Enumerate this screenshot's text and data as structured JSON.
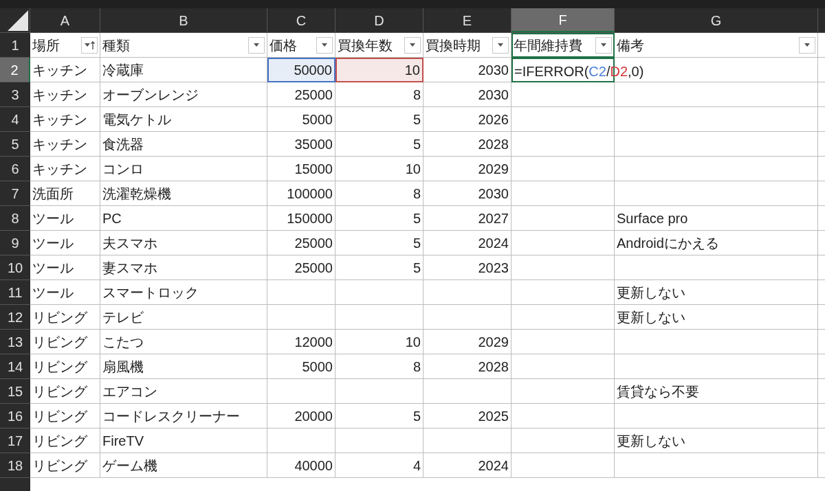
{
  "columns": [
    {
      "letter": "A",
      "selected": false,
      "kind": "text"
    },
    {
      "letter": "B",
      "selected": false,
      "kind": "text"
    },
    {
      "letter": "C",
      "selected": false,
      "kind": "number"
    },
    {
      "letter": "D",
      "selected": false,
      "kind": "number"
    },
    {
      "letter": "E",
      "selected": false,
      "kind": "number"
    },
    {
      "letter": "F",
      "selected": true,
      "kind": "number"
    },
    {
      "letter": "G",
      "selected": false,
      "kind": "text"
    }
  ],
  "rows": [
    {
      "number": "1",
      "selected": false,
      "kind": "header",
      "cells": [
        {
          "text": "場所",
          "kind": "sorted"
        },
        {
          "text": "種類",
          "kind": "dropdown"
        },
        {
          "text": "価格",
          "kind": "dropdown"
        },
        {
          "text": "買換年数",
          "kind": "dropdown"
        },
        {
          "text": "買換時期",
          "kind": "dropdown"
        },
        {
          "text": "年間維持費",
          "kind": "dropdown"
        },
        {
          "text": "備考",
          "kind": "dropdown"
        }
      ]
    },
    {
      "number": "2",
      "selected": true,
      "kind": "data",
      "cells": [
        {
          "text": "キッチン"
        },
        {
          "text": "冷蔵庫"
        },
        {
          "text": "50000",
          "color": "#4472c4"
        },
        {
          "text": "10",
          "color": "#c0504d"
        },
        {
          "text": "2030"
        },
        {
          "formula": [
            {
              "text": "=IFERROR("
            },
            {
              "text": "C2",
              "color": "#4a7fd9"
            },
            {
              "text": "/"
            },
            {
              "text": "D2",
              "color": "#d13438"
            },
            {
              "text": ",0)"
            }
          ]
        },
        {}
      ]
    },
    {
      "number": "3",
      "selected": false,
      "kind": "data",
      "cells": [
        {
          "text": "キッチン"
        },
        {
          "text": "オーブンレンジ"
        },
        {
          "text": "25000"
        },
        {
          "text": "8"
        },
        {
          "text": "2030"
        },
        {},
        {}
      ]
    },
    {
      "number": "4",
      "selected": false,
      "kind": "data",
      "cells": [
        {
          "text": "キッチン"
        },
        {
          "text": "電気ケトル"
        },
        {
          "text": "5000"
        },
        {
          "text": "5"
        },
        {
          "text": "2026"
        },
        {},
        {}
      ]
    },
    {
      "number": "5",
      "selected": false,
      "kind": "data",
      "cells": [
        {
          "text": "キッチン"
        },
        {
          "text": "食洗器"
        },
        {
          "text": "35000"
        },
        {
          "text": "5"
        },
        {
          "text": "2028"
        },
        {},
        {}
      ]
    },
    {
      "number": "6",
      "selected": false,
      "kind": "data",
      "cells": [
        {
          "text": "キッチン"
        },
        {
          "text": "コンロ"
        },
        {
          "text": "15000"
        },
        {
          "text": "10"
        },
        {
          "text": "2029"
        },
        {},
        {}
      ]
    },
    {
      "number": "7",
      "selected": false,
      "kind": "data",
      "cells": [
        {
          "text": "洗面所"
        },
        {
          "text": "洗濯乾燥機"
        },
        {
          "text": "100000"
        },
        {
          "text": "8"
        },
        {
          "text": "2030"
        },
        {},
        {}
      ]
    },
    {
      "number": "8",
      "selected": false,
      "kind": "data",
      "cells": [
        {
          "text": "ツール"
        },
        {
          "text": "PC"
        },
        {
          "text": "150000"
        },
        {
          "text": "5"
        },
        {
          "text": "2027"
        },
        {},
        {
          "text": "Surface pro"
        }
      ]
    },
    {
      "number": "9",
      "selected": false,
      "kind": "data",
      "cells": [
        {
          "text": "ツール"
        },
        {
          "text": "夫スマホ"
        },
        {
          "text": "25000"
        },
        {
          "text": "5"
        },
        {
          "text": "2024"
        },
        {},
        {
          "text": "Androidにかえる"
        }
      ]
    },
    {
      "number": "10",
      "selected": false,
      "kind": "data",
      "cells": [
        {
          "text": "ツール"
        },
        {
          "text": "妻スマホ"
        },
        {
          "text": "25000"
        },
        {
          "text": "5"
        },
        {
          "text": "2023"
        },
        {},
        {}
      ]
    },
    {
      "number": "11",
      "selected": false,
      "kind": "data",
      "cells": [
        {
          "text": "ツール"
        },
        {
          "text": "スマートロック"
        },
        {},
        {},
        {},
        {},
        {
          "text": "更新しない"
        }
      ]
    },
    {
      "number": "12",
      "selected": false,
      "kind": "data",
      "cells": [
        {
          "text": "リビング"
        },
        {
          "text": "テレビ"
        },
        {},
        {},
        {},
        {},
        {
          "text": "更新しない"
        }
      ]
    },
    {
      "number": "13",
      "selected": false,
      "kind": "data",
      "cells": [
        {
          "text": "リビング"
        },
        {
          "text": "こたつ"
        },
        {
          "text": "12000"
        },
        {
          "text": "10"
        },
        {
          "text": "2029"
        },
        {},
        {}
      ]
    },
    {
      "number": "14",
      "selected": false,
      "kind": "data",
      "cells": [
        {
          "text": "リビング"
        },
        {
          "text": "扇風機"
        },
        {
          "text": "5000"
        },
        {
          "text": "8"
        },
        {
          "text": "2028"
        },
        {},
        {}
      ]
    },
    {
      "number": "15",
      "selected": false,
      "kind": "data",
      "cells": [
        {
          "text": "リビング"
        },
        {
          "text": "エアコン"
        },
        {},
        {},
        {},
        {},
        {
          "text": "賃貸なら不要"
        }
      ]
    },
    {
      "number": "16",
      "selected": false,
      "kind": "data",
      "cells": [
        {
          "text": "リビング"
        },
        {
          "text": "コードレスクリーナー"
        },
        {
          "text": "20000"
        },
        {
          "text": "5"
        },
        {
          "text": "2025"
        },
        {},
        {}
      ]
    },
    {
      "number": "17",
      "selected": false,
      "kind": "data",
      "cells": [
        {
          "text": "リビング"
        },
        {
          "text": "FireTV"
        },
        {},
        {},
        {},
        {},
        {
          "text": "更新しない"
        }
      ]
    },
    {
      "number": "18",
      "selected": false,
      "kind": "data",
      "cells": [
        {
          "text": "リビング"
        },
        {
          "text": "ゲーム機"
        },
        {
          "text": "40000"
        },
        {
          "text": "4"
        },
        {
          "text": "2024"
        },
        {},
        {}
      ]
    }
  ]
}
